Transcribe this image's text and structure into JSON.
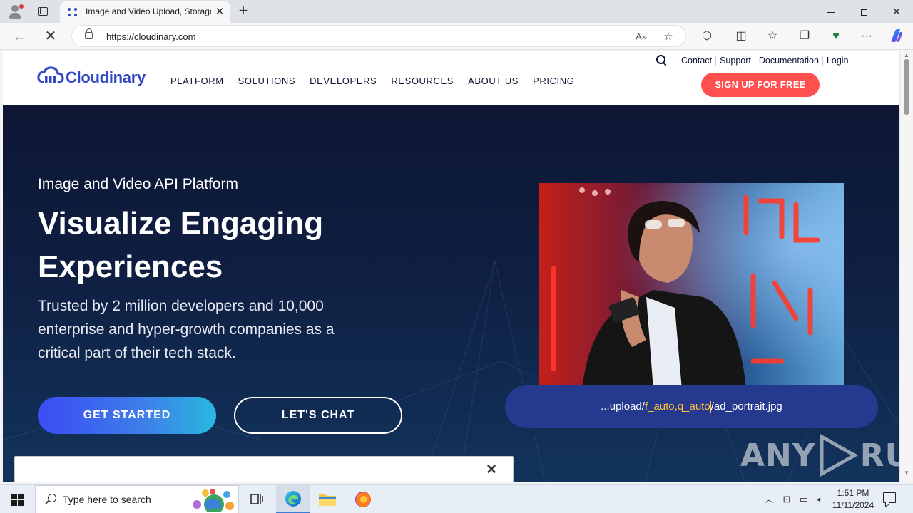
{
  "browser": {
    "tab_title": "Image and Video Upload, Storage, Optimization and CDN",
    "tab_close_icon": "close-icon",
    "new_tab_icon": "plus-icon",
    "url": "https://cloudinary.com",
    "window_controls": [
      "minimize-icon",
      "restore-icon",
      "close-icon"
    ]
  },
  "site": {
    "logo_text": "Cloudinary",
    "brand_color": "#3448c5",
    "main_nav": [
      "PLATFORM",
      "SOLUTIONS",
      "DEVELOPERS",
      "RESOURCES",
      "ABOUT US",
      "PRICING"
    ],
    "util_nav": [
      "Contact",
      "Support",
      "Documentation",
      "Login"
    ],
    "signup_label": "SIGN UP FOR FREE",
    "signup_color": "#ff5050"
  },
  "hero": {
    "kicker": "Image and Video API Platform",
    "headline": "Visualize Engaging Experiences",
    "subtext": "Trusted by 2 million developers and 10,000 enterprise and hyper-growth companies as a critical part of their tech stack.",
    "cta_primary": "GET STARTED",
    "cta_secondary": "LET'S CHAT",
    "url_prefix": "...upload/",
    "url_highlight": "f_auto,q_auto",
    "url_suffix": "/ad_portrait.jpg",
    "highlight_color": "#ffbf3c",
    "cookie_close_icon": "close-icon"
  },
  "watermark": {
    "text_left": "ANY",
    "text_right": "RUN"
  },
  "taskbar": {
    "search_placeholder": "Type here to search",
    "time": "1:51 PM",
    "date": "11/11/2024",
    "pinned_apps": [
      "task-view-icon",
      "edge-icon",
      "file-explorer-icon",
      "firefox-icon"
    ],
    "tray_icons": [
      "chevron-up-icon",
      "meet-now-icon",
      "network-icon",
      "volume-icon"
    ]
  }
}
